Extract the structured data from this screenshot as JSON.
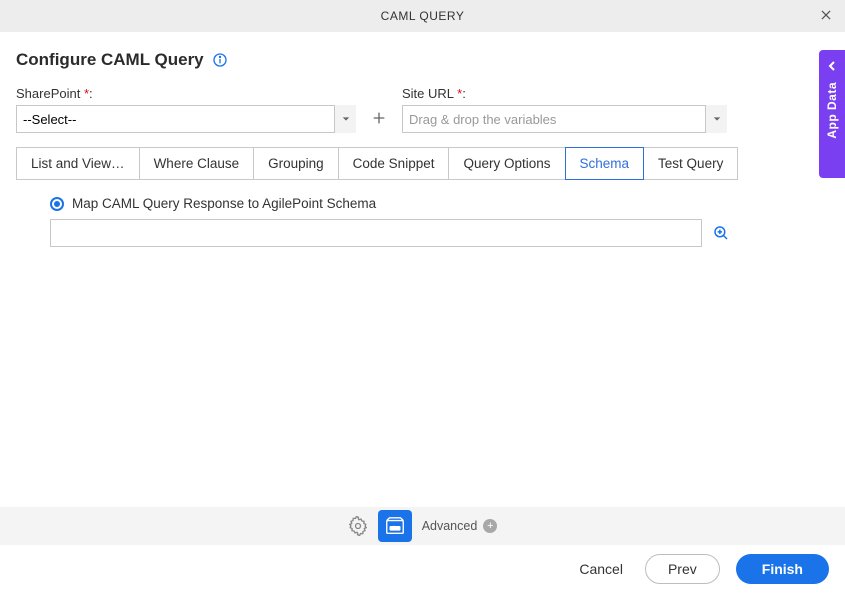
{
  "header": {
    "title": "CAML QUERY"
  },
  "page": {
    "title": "Configure CAML Query"
  },
  "fields": {
    "sharepoint_label": "SharePoint ",
    "sharepoint_required": "*",
    "sharepoint_colon": ":",
    "sharepoint_value": "--Select--",
    "siteurl_label": "Site URL ",
    "siteurl_required": "*",
    "siteurl_colon": ":",
    "siteurl_placeholder": "Drag & drop the variables"
  },
  "tabs": [
    {
      "label": "List and View…"
    },
    {
      "label": "Where Clause"
    },
    {
      "label": "Grouping"
    },
    {
      "label": "Code Snippet"
    },
    {
      "label": "Query Options"
    },
    {
      "label": "Schema"
    },
    {
      "label": "Test Query"
    }
  ],
  "active_tab_index": 5,
  "schema": {
    "radio_label": "Map CAML Query Response to AgilePoint Schema",
    "input_value": ""
  },
  "sideTab": {
    "label": "App Data"
  },
  "footer": {
    "advanced_label": "Advanced",
    "cancel": "Cancel",
    "prev": "Prev",
    "finish": "Finish"
  }
}
